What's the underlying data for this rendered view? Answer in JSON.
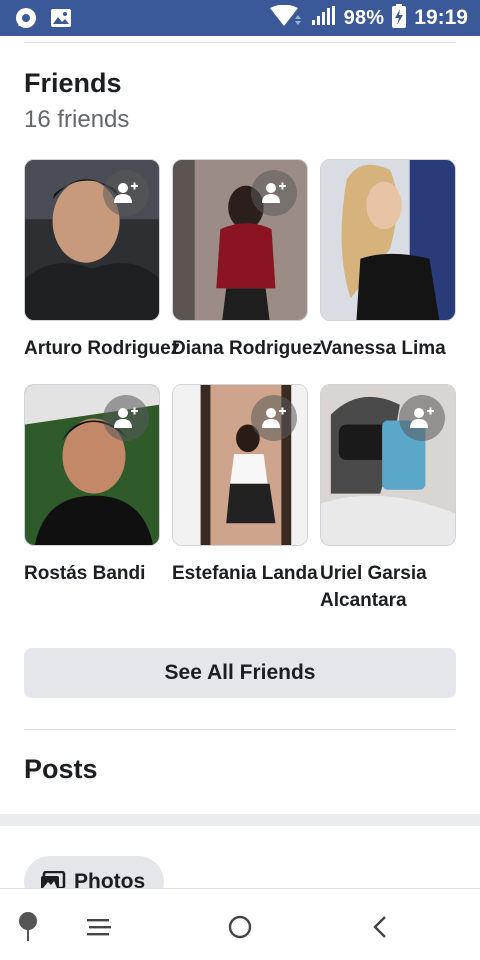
{
  "status_bar": {
    "battery": "98%",
    "time": "19:19",
    "icons": [
      "messenger-icon",
      "image-icon",
      "wifi-icon",
      "signal-icon",
      "battery-charging-icon"
    ]
  },
  "friends": {
    "title": "Friends",
    "count_label": "16 friends",
    "items": [
      {
        "name": "Arturo Rodriguez"
      },
      {
        "name": "Diana Rodriguez"
      },
      {
        "name": "Vanessa Lima"
      },
      {
        "name": "Rostás Bandi"
      },
      {
        "name": "Estefania Landa"
      },
      {
        "name": "Uriel Garsia Alcantara"
      }
    ],
    "see_all_label": "See All Friends"
  },
  "posts": {
    "title": "Posts",
    "photos_chip_label": "Photos"
  },
  "colors": {
    "status_bar": "#3b5998",
    "button_bg": "#e4e6eb",
    "secondary_text": "#65676b"
  },
  "nav": {
    "icons": [
      "pin-icon",
      "menu-icon",
      "home-circle-icon",
      "back-icon"
    ]
  }
}
